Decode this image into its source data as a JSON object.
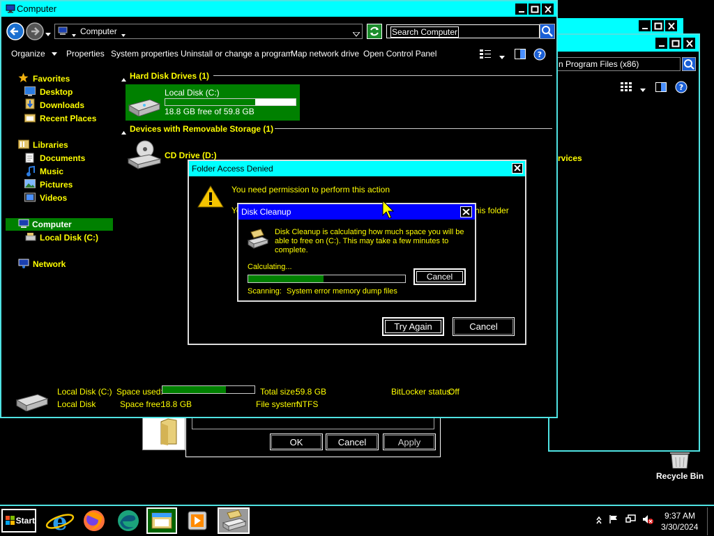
{
  "back_window_2": {
    "address_text": "n Program Files (x86)",
    "partial_label": "rvices"
  },
  "explorer": {
    "title": "Computer",
    "breadcrumb": "Computer",
    "search_placeholder": "Search Computer",
    "toolbar": [
      "Organize",
      "Properties",
      "System properties",
      "Uninstall or change a program",
      "Map network drive",
      "Open Control Panel"
    ],
    "nav": {
      "favorites": "Favorites",
      "fav_items": [
        "Desktop",
        "Downloads",
        "Recent Places"
      ],
      "libraries": "Libraries",
      "lib_items": [
        "Documents",
        "Music",
        "Pictures",
        "Videos"
      ],
      "computer": "Computer",
      "local_disk": "Local Disk (C:)",
      "network": "Network"
    },
    "hdd_section": "Hard Disk Drives (1)",
    "removable_section": "Devices with Removable Storage (1)",
    "drive_c": {
      "name": "Local Disk (C:)",
      "free_text": "18.8 GB free of 59.8 GB",
      "used_fraction": 0.69
    },
    "drive_d": {
      "name": "CD Drive (D:)"
    },
    "details": {
      "name": "Local Disk (C:)",
      "type": "Local Disk",
      "space_used_label": "Space used:",
      "space_free_label": "Space free:",
      "space_free_value": "18.8 GB",
      "used_fraction": 0.69,
      "total_size_label": "Total size:",
      "total_size_value": "59.8 GB",
      "file_system_label": "File system:",
      "file_system_value": "NTFS",
      "bitlocker_label": "BitLocker status:",
      "bitlocker_value": "Off"
    }
  },
  "properties_dialog": {
    "ok": "OK",
    "cancel": "Cancel",
    "apply": "Apply"
  },
  "access_denied": {
    "title": "Folder Access Denied",
    "message": "You need permission to perform this action",
    "partial_left": "Yo",
    "partial_right": "his folder",
    "try_again": "Try Again",
    "cancel": "Cancel"
  },
  "disk_cleanup": {
    "title": "Disk Cleanup",
    "message": "Disk Cleanup is calculating how much space you will be able to free on  (C:). This may take a few minutes to complete.",
    "status": "Calculating...",
    "progress_fraction": 0.48,
    "cancel": "Cancel",
    "scanning_label": "Scanning:",
    "scanning_item": "System error memory dump files"
  },
  "desktop": {
    "recycle_bin": "Recycle Bin"
  },
  "taskbar": {
    "start": "Start",
    "time": "9:37 AM",
    "date": "3/30/2024"
  },
  "colors": {
    "accent": "#00ffff",
    "highlight_text": "#ffff00",
    "progress": "#008000",
    "dialog_title_blue": "#0000ff"
  }
}
